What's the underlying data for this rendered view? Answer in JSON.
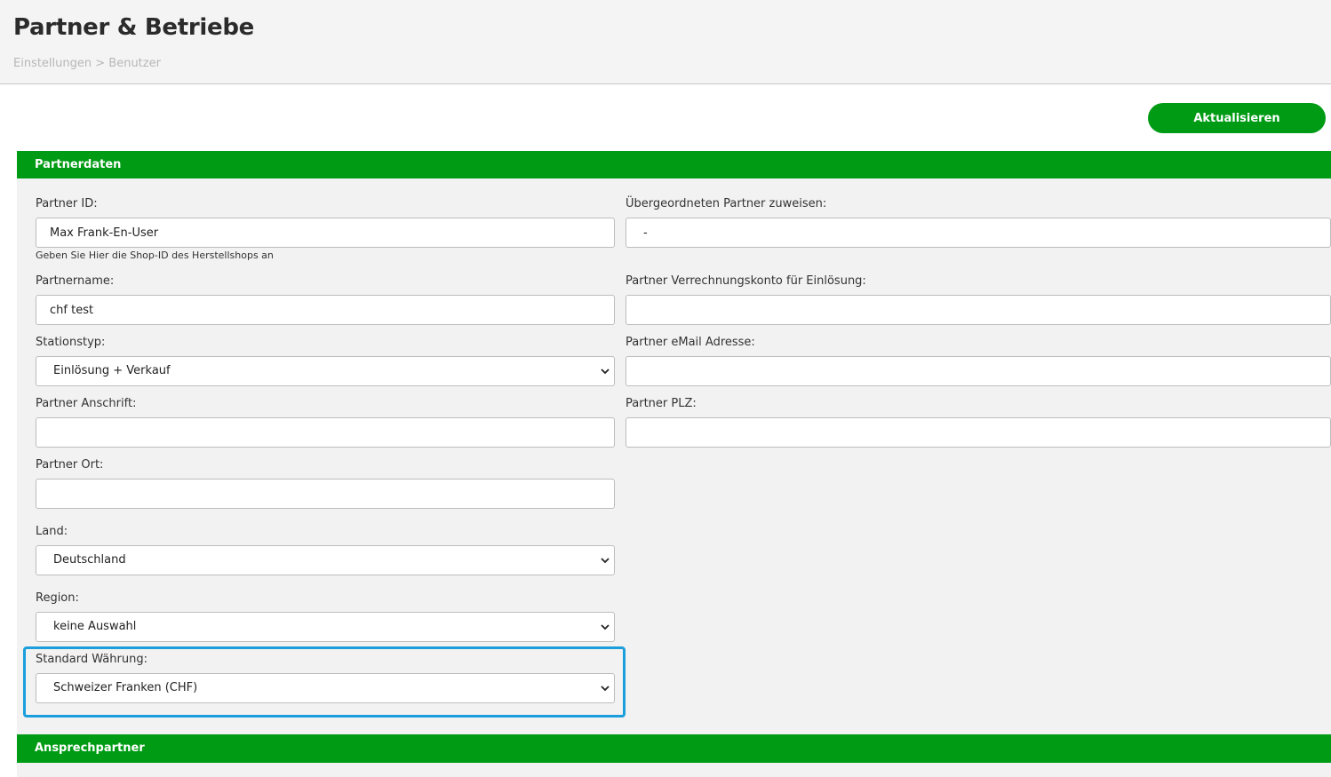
{
  "header": {
    "title": "Partner & Betriebe",
    "breadcrumb": "Einstellungen > Benutzer"
  },
  "toolbar": {
    "update_label": "Aktualisieren"
  },
  "sections": {
    "partnerdaten": "Partnerdaten",
    "ansprechpartner": "Ansprechpartner"
  },
  "form": {
    "partner_id": {
      "label": "Partner ID:",
      "value": "Max Frank-En-User",
      "hint": "Geben Sie Hier die Shop-ID des Herstellshops an"
    },
    "parent_partner": {
      "label": "Übergeordneten Partner zuweisen:",
      "value": "-"
    },
    "partner_name": {
      "label": "Partnername:",
      "value": "chf test"
    },
    "billing_account": {
      "label": "Partner Verrechnungskonto für Einlösung:",
      "value": ""
    },
    "station_type": {
      "label": "Stationstyp:",
      "selected": "Einlösung + Verkauf"
    },
    "email": {
      "label": "Partner eMail Adresse:",
      "value": ""
    },
    "address": {
      "label": "Partner Anschrift:",
      "value": ""
    },
    "zip": {
      "label": "Partner PLZ:",
      "value": ""
    },
    "city": {
      "label": "Partner Ort:",
      "value": ""
    },
    "country": {
      "label": "Land:",
      "selected": "Deutschland"
    },
    "region": {
      "label": "Region:",
      "selected": "keine Auswahl"
    },
    "currency": {
      "label": "Standard Währung:",
      "selected": "Schweizer Franken (CHF)"
    }
  },
  "icons": {
    "select_arrow": "chevron-down-icon"
  },
  "colors": {
    "accent": "#009b14",
    "highlight": "#1a9fdc",
    "panel": "#f2f2f2"
  }
}
